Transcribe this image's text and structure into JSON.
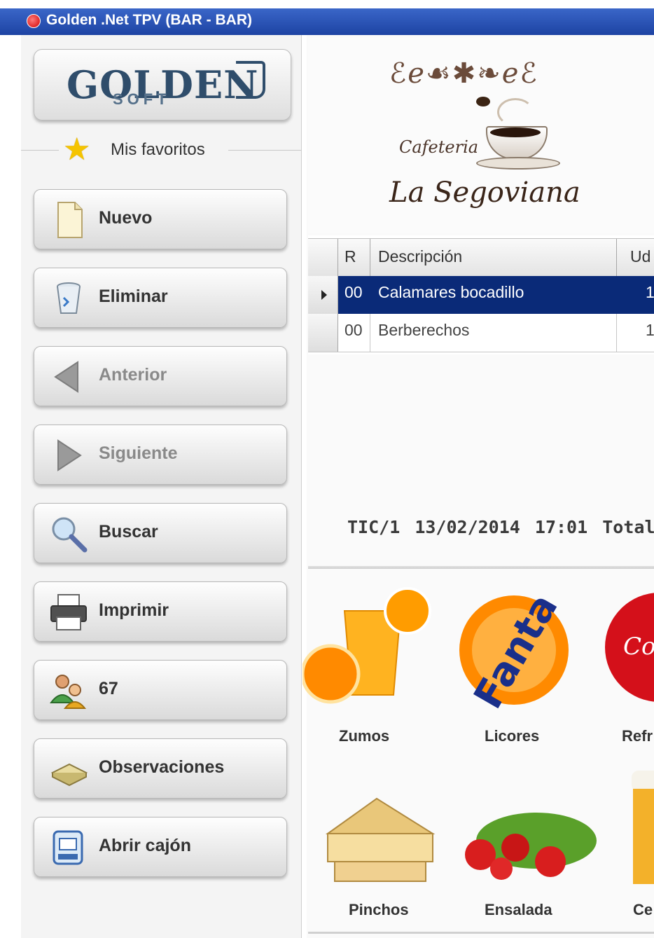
{
  "window": {
    "title": "Golden .Net TPV (BAR -  BAR)"
  },
  "sidebar": {
    "logo": {
      "brand": "GOLDEN",
      "sub": "SOFT"
    },
    "favorites_label": "Mis favoritos",
    "buttons": [
      {
        "label": "Nuevo",
        "icon": "new-document-icon",
        "enabled": true
      },
      {
        "label": "Eliminar",
        "icon": "recycle-bin-icon",
        "enabled": true
      },
      {
        "label": "Anterior",
        "icon": "arrow-left-icon",
        "enabled": false
      },
      {
        "label": "Siguiente",
        "icon": "arrow-right-icon",
        "enabled": false
      },
      {
        "label": "Buscar",
        "icon": "magnifier-icon",
        "enabled": true
      },
      {
        "label": "Imprimir",
        "icon": "printer-icon",
        "enabled": true
      },
      {
        "label": "67",
        "icon": "users-icon",
        "enabled": true
      },
      {
        "label": "Observaciones",
        "icon": "notepad-icon",
        "enabled": true
      },
      {
        "label": "Abrir cajón",
        "icon": "cash-drawer-icon",
        "enabled": true
      }
    ]
  },
  "business": {
    "small": "Cafeteria",
    "name": "La Segoviana"
  },
  "grid": {
    "columns": [
      "R",
      "Descripción",
      "Ud"
    ],
    "rows": [
      {
        "r": "00",
        "desc": "Calamares bocadillo",
        "ud": "1",
        "selected": true
      },
      {
        "r": "00",
        "desc": "Berberechos",
        "ud": "1",
        "selected": false
      }
    ]
  },
  "ticket": {
    "id": "TIC/1",
    "date": "13/02/2014",
    "time": "17:01",
    "total_label": "Total"
  },
  "categories": [
    {
      "label": "Zumos",
      "icon": "orange-juice-icon"
    },
    {
      "label": "Licores",
      "icon": "fanta-icon"
    },
    {
      "label": "Refr",
      "icon": "coca-cola-icon"
    },
    {
      "label": "Pinchos",
      "icon": "tortilla-icon"
    },
    {
      "label": "Ensalada",
      "icon": "salad-icon"
    },
    {
      "label": "Ce",
      "icon": "beer-icon"
    }
  ],
  "colors": {
    "titlebar": "#2a52b4",
    "selection": "#0a2a78",
    "accent": "#f5c400"
  }
}
